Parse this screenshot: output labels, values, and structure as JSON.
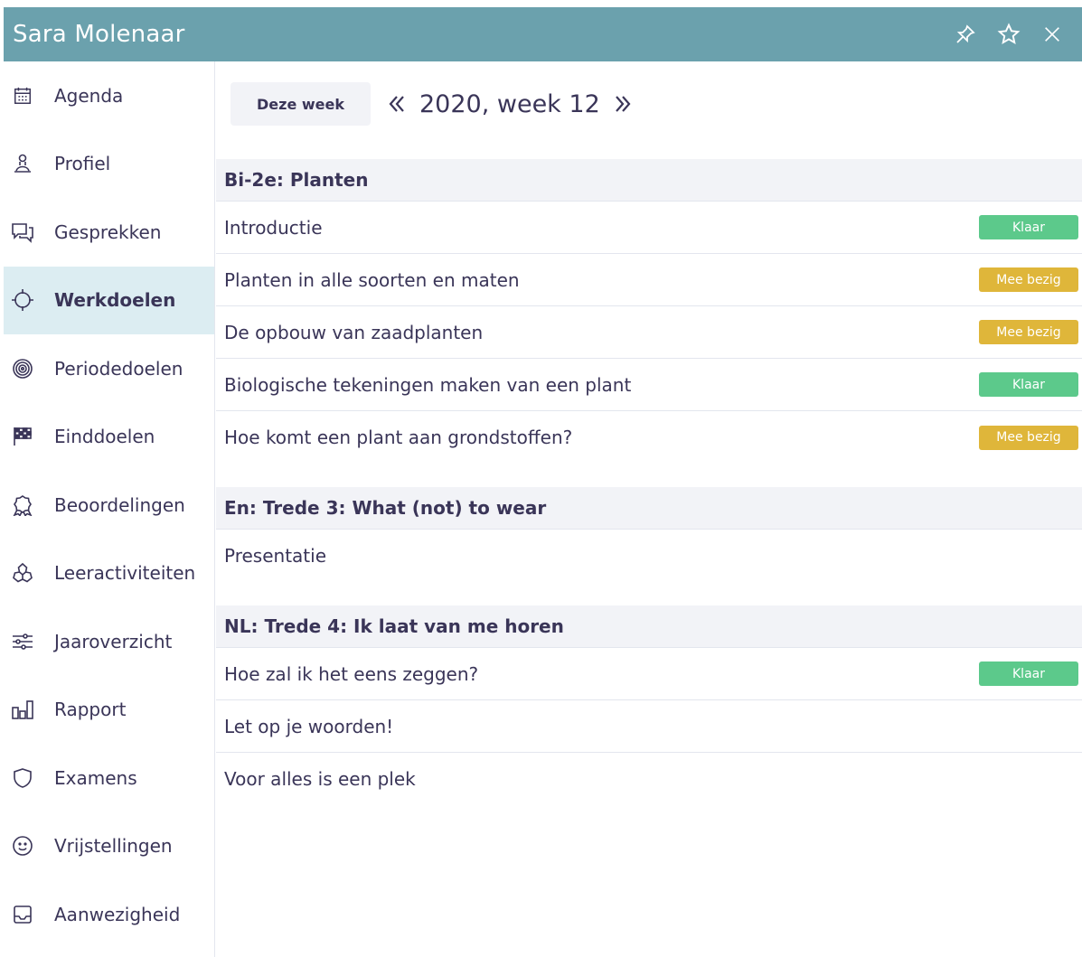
{
  "window": {
    "title": "Sara Molenaar",
    "actions": [
      {
        "name": "pin-icon"
      },
      {
        "name": "star-icon"
      },
      {
        "name": "close-icon"
      }
    ]
  },
  "sidebar": {
    "items": [
      {
        "label": "Agenda",
        "icon": "calendar-icon",
        "active": false
      },
      {
        "label": "Profiel",
        "icon": "profile-icon",
        "active": false
      },
      {
        "label": "Gesprekken",
        "icon": "chat-icon",
        "active": false
      },
      {
        "label": "Werkdoelen",
        "icon": "crosshair-icon",
        "active": true
      },
      {
        "label": "Periodedoelen",
        "icon": "target-icon",
        "active": false
      },
      {
        "label": "Einddoelen",
        "icon": "checkered-flag-icon",
        "active": false
      },
      {
        "label": "Beoordelingen",
        "icon": "award-icon",
        "active": false
      },
      {
        "label": "Leeractiviteiten",
        "icon": "activities-icon",
        "active": false
      },
      {
        "label": "Jaaroverzicht",
        "icon": "sliders-icon",
        "active": false
      },
      {
        "label": "Rapport",
        "icon": "bar-chart-icon",
        "active": false
      },
      {
        "label": "Examens",
        "icon": "shield-icon",
        "active": false
      },
      {
        "label": "Vrijstellingen",
        "icon": "smiley-icon",
        "active": false
      },
      {
        "label": "Aanwezigheid",
        "icon": "inbox-icon",
        "active": false
      }
    ]
  },
  "week_nav": {
    "this_week_label": "Deze week",
    "week_label": "2020, week 12"
  },
  "colors": {
    "titlebar": "#6ba1ad",
    "active_nav": "#dcedf2",
    "done": "#5cc98b",
    "busy": "#dfb63a",
    "text": "#3a3558"
  },
  "groups": [
    {
      "title": "Bi-2e: Planten",
      "tasks": [
        {
          "label": "Introductie",
          "status": "Klaar",
          "status_kind": "done"
        },
        {
          "label": "Planten in alle soorten en maten",
          "status": "Mee bezig",
          "status_kind": "busy"
        },
        {
          "label": "De opbouw van zaadplanten",
          "status": "Mee bezig",
          "status_kind": "busy"
        },
        {
          "label": "Biologische tekeningen maken van een plant",
          "status": "Klaar",
          "status_kind": "done"
        },
        {
          "label": "Hoe komt een plant aan grondstoffen?",
          "status": "Mee bezig",
          "status_kind": "busy"
        }
      ]
    },
    {
      "title": "En: Trede 3: What (not) to wear",
      "tasks": [
        {
          "label": "Presentatie",
          "status": "",
          "status_kind": ""
        }
      ]
    },
    {
      "title": "NL: Trede 4: Ik laat van me horen",
      "tasks": [
        {
          "label": "Hoe zal ik het eens zeggen?",
          "status": "Klaar",
          "status_kind": "done"
        },
        {
          "label": "Let op je woorden!",
          "status": "",
          "status_kind": ""
        },
        {
          "label": "Voor alles is een plek",
          "status": "",
          "status_kind": ""
        }
      ]
    }
  ]
}
